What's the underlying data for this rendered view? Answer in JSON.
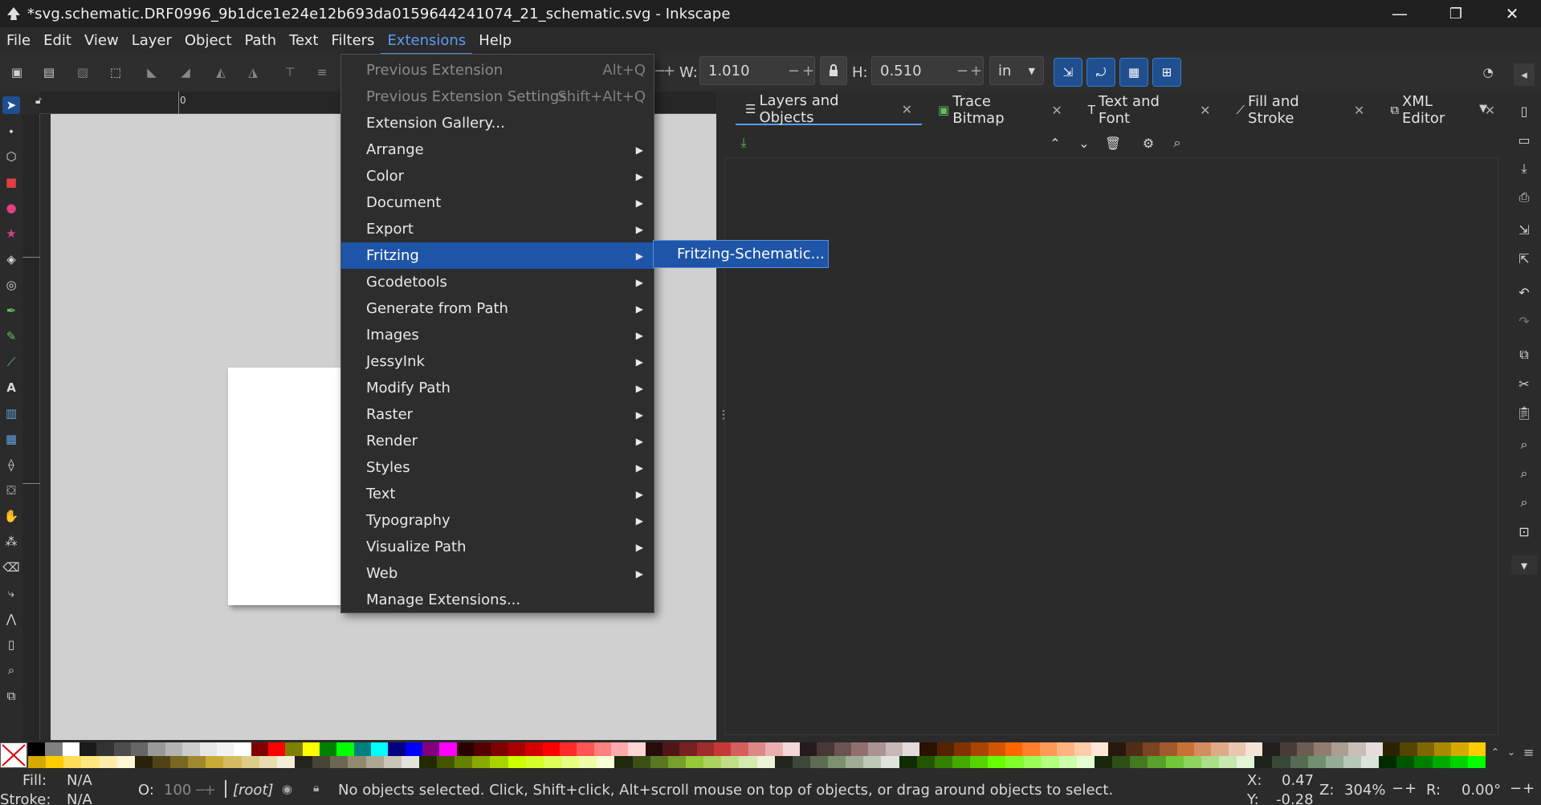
{
  "window": {
    "title": "*svg.schematic.DRF0996_9b1dce1e24e12b693da0159644241074_21_schematic.svg - Inkscape",
    "minimize": "—",
    "maximize": "❐",
    "close": "✕"
  },
  "menubar": [
    "File",
    "Edit",
    "View",
    "Layer",
    "Object",
    "Path",
    "Text",
    "Filters",
    "Extensions",
    "Help"
  ],
  "toolcontrols": {
    "w_label": "W:",
    "w_value": "1.010",
    "h_label": "H:",
    "h_value": "0.510",
    "unit": "in",
    "minus": "−",
    "plus": "+"
  },
  "ruler": {
    "zero_label": "0"
  },
  "extensions_menu": [
    {
      "label": "Previous Extension",
      "shortcut": "Alt+Q",
      "disabled": true
    },
    {
      "label": "Previous Extension Settings...",
      "shortcut": "Shift+Alt+Q",
      "disabled": true
    },
    {
      "label": "Extension Gallery..."
    },
    {
      "label": "Arrange",
      "submenu": true
    },
    {
      "label": "Color",
      "submenu": true
    },
    {
      "label": "Document",
      "submenu": true
    },
    {
      "label": "Export",
      "submenu": true
    },
    {
      "label": "Fritzing",
      "submenu": true,
      "highlighted": true
    },
    {
      "label": "Gcodetools",
      "submenu": true
    },
    {
      "label": "Generate from Path",
      "submenu": true
    },
    {
      "label": "Images",
      "submenu": true
    },
    {
      "label": "JessyInk",
      "submenu": true
    },
    {
      "label": "Modify Path",
      "submenu": true
    },
    {
      "label": "Raster",
      "submenu": true
    },
    {
      "label": "Render",
      "submenu": true
    },
    {
      "label": "Styles",
      "submenu": true
    },
    {
      "label": "Text",
      "submenu": true
    },
    {
      "label": "Typography",
      "submenu": true
    },
    {
      "label": "Visualize Path",
      "submenu": true
    },
    {
      "label": "Web",
      "submenu": true
    },
    {
      "label": "Manage Extensions..."
    }
  ],
  "fritzing_submenu": [
    "Fritzing-Schematic..."
  ],
  "dock": {
    "tabs": [
      {
        "label": "Layers and Objects",
        "icon": "layers-icon",
        "active": true
      },
      {
        "label": "Trace Bitmap",
        "icon": "trace-bitmap-icon"
      },
      {
        "label": "Text and Font",
        "icon": "text-font-icon"
      },
      {
        "label": "Fill and Stroke",
        "icon": "fill-stroke-icon"
      },
      {
        "label": "XML Editor",
        "icon": "xml-editor-icon"
      }
    ]
  },
  "status": {
    "fill_label": "Fill:",
    "fill_value": "N/A",
    "stroke_label": "Stroke:",
    "stroke_value": "N/A",
    "opacity_label": "O:",
    "opacity_value": "100",
    "layer": "[root]",
    "message": "No objects selected. Click, Shift+click, Alt+scroll mouse on top of objects, or drag around objects to select.",
    "x_label": "X:",
    "x_value": "0.47",
    "y_label": "Y:",
    "y_value": "-0.28",
    "zoom_label": "Z:",
    "zoom_value": "304%",
    "rotation_label": "R:",
    "rotation_value": "0.00°"
  },
  "palette": {
    "row1": [
      "#000000",
      "#808080",
      "#ffffff",
      "#1a1a1a",
      "#333333",
      "#4d4d4d",
      "#666666",
      "#999999",
      "#b3b3b3",
      "#cccccc",
      "#e6e6e6",
      "#f2f2f2",
      "#ffffff",
      "#800000",
      "#ff0000",
      "#808000",
      "#ffff00",
      "#008000",
      "#00ff00",
      "#008080",
      "#00ffff",
      "#000080",
      "#0000ff",
      "#800080",
      "#ff00ff",
      "#2b0000",
      "#550000",
      "#800000",
      "#aa0000",
      "#d40000",
      "#ff0000",
      "#ff2a2a",
      "#ff5555",
      "#ff8080",
      "#ffaaaa",
      "#ffd5d5",
      "#280b0b",
      "#501616",
      "#782121",
      "#a02c2c",
      "#c83737",
      "#d35f5f",
      "#de8787",
      "#e9afaf",
      "#f4d7d7",
      "#241c1c",
      "#483737",
      "#6c5353",
      "#916f6f",
      "#ac9393",
      "#c8b7b7",
      "#e3dbdb",
      "#2b1100",
      "#552200",
      "#803300",
      "#aa4400",
      "#d45500",
      "#ff6600",
      "#ff7f2a",
      "#ff9955",
      "#ffb380",
      "#ffccaa",
      "#ffe6d5",
      "#28170b",
      "#502d16",
      "#784421",
      "#a05a2c",
      "#c87137",
      "#d38d5f",
      "#deaa87",
      "#e9c6af",
      "#f4e3d7",
      "#241f1c",
      "#483e37",
      "#6c5d53",
      "#917c6f",
      "#ac9d93",
      "#c8beb7",
      "#e3dedb",
      "#2b2200",
      "#554400",
      "#806600",
      "#aa8800",
      "#d4aa00",
      "#ffcc00"
    ],
    "row2": [
      "#d4aa00",
      "#ffcc00",
      "#ffdd55",
      "#ffe680",
      "#ffeeaa",
      "#fff6d5",
      "#28220b",
      "#504416",
      "#786721",
      "#a0892c",
      "#c8ab37",
      "#d3bc5f",
      "#decd87",
      "#e9ddaf",
      "#f4eed7",
      "#24221c",
      "#484537",
      "#6c6753",
      "#918a6f",
      "#aca793",
      "#c8c4b7",
      "#e3e2db",
      "#222b00",
      "#445500",
      "#668000",
      "#88aa00",
      "#aad400",
      "#ccff00",
      "#d4ff2a",
      "#ddff55",
      "#e5ff80",
      "#eeffaa",
      "#f6ffd5",
      "#1e280b",
      "#3c5016",
      "#5a7821",
      "#78a02c",
      "#96c837",
      "#abd35f",
      "#c1de87",
      "#d6e9af",
      "#ebf4d7",
      "#1f241c",
      "#3e4837",
      "#5d6c53",
      "#7c916f",
      "#9dac93",
      "#bec8b7",
      "#dee3db",
      "#112b00",
      "#225500",
      "#338000",
      "#44aa00",
      "#55d400",
      "#66ff00",
      "#7fff2a",
      "#99ff55",
      "#b3ff80",
      "#ccffaa",
      "#e5ffd5",
      "#17280b",
      "#2d5016",
      "#447821",
      "#5aa02c",
      "#71c837",
      "#8dd35f",
      "#aade87",
      "#c6e9af",
      "#e3f4d7",
      "#1c241c",
      "#374837",
      "#536c53",
      "#6f916f",
      "#93ac93",
      "#b7c8b7",
      "#dbe3db",
      "#002b00",
      "#005500",
      "#008000",
      "#00aa00",
      "#00d400",
      "#00ff00"
    ]
  }
}
